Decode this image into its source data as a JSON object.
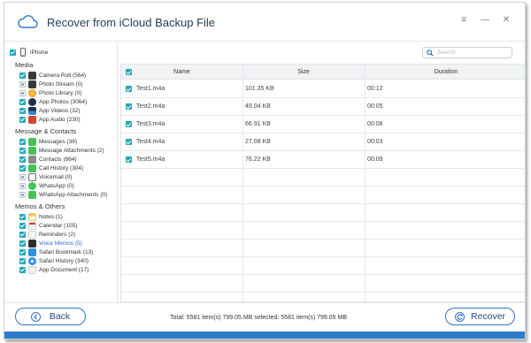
{
  "window": {
    "title": "Recover from iCloud Backup File"
  },
  "device": {
    "label": "iPhone"
  },
  "sidebar": {
    "groups": [
      {
        "label": "Media",
        "items": [
          {
            "label": "Camera Roll (564)",
            "icon_color": "#3a3a3a",
            "checked": true
          },
          {
            "label": "Photo Stream (0)",
            "icon_color": "#3a3a3a",
            "checked": false
          },
          {
            "label": "Photo Library (0)",
            "icon_color": "#e8912d",
            "checked": false
          },
          {
            "label": "App Photos (3064)",
            "icon_color": "#1c2f4a",
            "checked": true
          },
          {
            "label": "App Videos (32)",
            "icon_color": "#1c2f4a",
            "checked": true
          },
          {
            "label": "App Audio (230)",
            "icon_color": "#d64234",
            "checked": true
          }
        ]
      },
      {
        "label": "Message & Contacts",
        "items": [
          {
            "label": "Messages (38)",
            "icon_color": "#44c256",
            "checked": true
          },
          {
            "label": "Message Attachments (2)",
            "icon_color": "#44c256",
            "checked": true
          },
          {
            "label": "Contacts (864)",
            "icon_color": "#8a8a8a",
            "checked": true
          },
          {
            "label": "Call History (304)",
            "icon_color": "#44c256",
            "checked": true
          },
          {
            "label": "Voicemail (0)",
            "icon_color": "#6b6b6b",
            "checked": false
          },
          {
            "label": "WhatsApp (0)",
            "icon_color": "#44c256",
            "checked": false
          },
          {
            "label": "WhatsApp Attachments (0)",
            "icon_color": "#44c256",
            "checked": false
          }
        ]
      },
      {
        "label": "Memos & Others",
        "items": [
          {
            "label": "Notes (1)",
            "icon_color": "#f2d04b",
            "checked": true
          },
          {
            "label": "Calendar (105)",
            "icon_color": "#e9e9e9",
            "checked": true
          },
          {
            "label": "Reminders (2)",
            "icon_color": "#f2f2f2",
            "checked": true
          },
          {
            "label": "Voice Memos (5)",
            "icon_color": "#2d2d2d",
            "checked": true,
            "active": true
          },
          {
            "label": "Safari Bookmark (13)",
            "icon_color": "#2f8de4",
            "checked": true
          },
          {
            "label": "Safari History (340)",
            "icon_color": "#2f8de4",
            "checked": true
          },
          {
            "label": "App Document (17)",
            "icon_color": "#e4e4e4",
            "checked": true
          }
        ]
      }
    ]
  },
  "search": {
    "placeholder": "Search"
  },
  "table": {
    "columns": [
      "Name",
      "Size",
      "Duration"
    ],
    "rows": [
      {
        "name": "Test1.m4a",
        "size": "101.35 KB",
        "duration": "00:12"
      },
      {
        "name": "Test2.m4a",
        "size": "49.04 KB",
        "duration": "00:05"
      },
      {
        "name": "Test3.m4a",
        "size": "66.91 KB",
        "duration": "00:08"
      },
      {
        "name": "Test4.m4a",
        "size": "27.08 KB",
        "duration": "00:03"
      },
      {
        "name": "Test5.m4a",
        "size": "76.22 KB",
        "duration": "00:09"
      }
    ]
  },
  "footer": {
    "back_label": "Back",
    "recover_label": "Recover",
    "status": "Total: 5581 item(s) 799.05 MB   selected: 5581 item(s) 799.05 MB"
  },
  "colors": {
    "accent": "#22a7b8",
    "brand": "#2e7bc8",
    "button_border": "#3573c4"
  }
}
